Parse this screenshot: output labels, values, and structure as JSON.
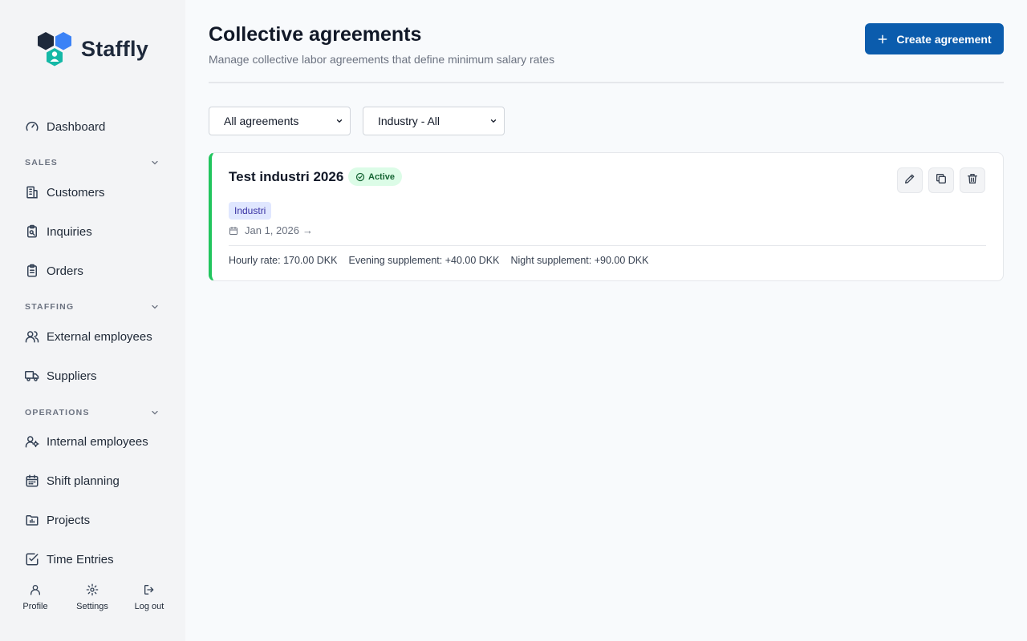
{
  "app": {
    "brand": "Staffly",
    "accent_color": "#0b5cad",
    "active_color": "#22c55e"
  },
  "sidebar": {
    "dashboard": {
      "label": "Dashboard",
      "icon": "gauge-icon"
    },
    "sections": [
      {
        "title": "SALES",
        "items": [
          {
            "label": "Customers",
            "icon": "building-icon"
          },
          {
            "label": "Inquiries",
            "icon": "clipboard-search-icon"
          },
          {
            "label": "Orders",
            "icon": "clipboard-list-icon"
          }
        ]
      },
      {
        "title": "STAFFING",
        "items": [
          {
            "label": "External employees",
            "icon": "users-icon"
          },
          {
            "label": "Suppliers",
            "icon": "truck-icon"
          }
        ]
      },
      {
        "title": "OPERATIONS",
        "items": [
          {
            "label": "Internal employees",
            "icon": "user-cog-icon"
          },
          {
            "label": "Shift planning",
            "icon": "calendar-icon"
          },
          {
            "label": "Projects",
            "icon": "folder-chart-icon"
          },
          {
            "label": "Time Entries",
            "icon": "check-square-icon"
          }
        ]
      }
    ],
    "bottom": {
      "profile": "Profile",
      "settings": "Settings",
      "logout": "Log out"
    }
  },
  "header": {
    "title": "Collective agreements",
    "subtitle": "Manage collective labor agreements that define minimum salary rates",
    "create_button": "Create agreement"
  },
  "filters": {
    "status": {
      "selected": "All agreements"
    },
    "industry": {
      "selected": "Industry - All"
    }
  },
  "agreements": [
    {
      "name": "Test industri 2026",
      "status": "Active",
      "industry": "Industri",
      "date_range": "Jan 1, 2026",
      "date_arrow": "→",
      "hourly_rate": "Hourly rate: 170.00 DKK",
      "evening_supplement": "Evening supplement: +40.00 DKK",
      "night_supplement": "Night supplement: +90.00 DKK"
    }
  ]
}
